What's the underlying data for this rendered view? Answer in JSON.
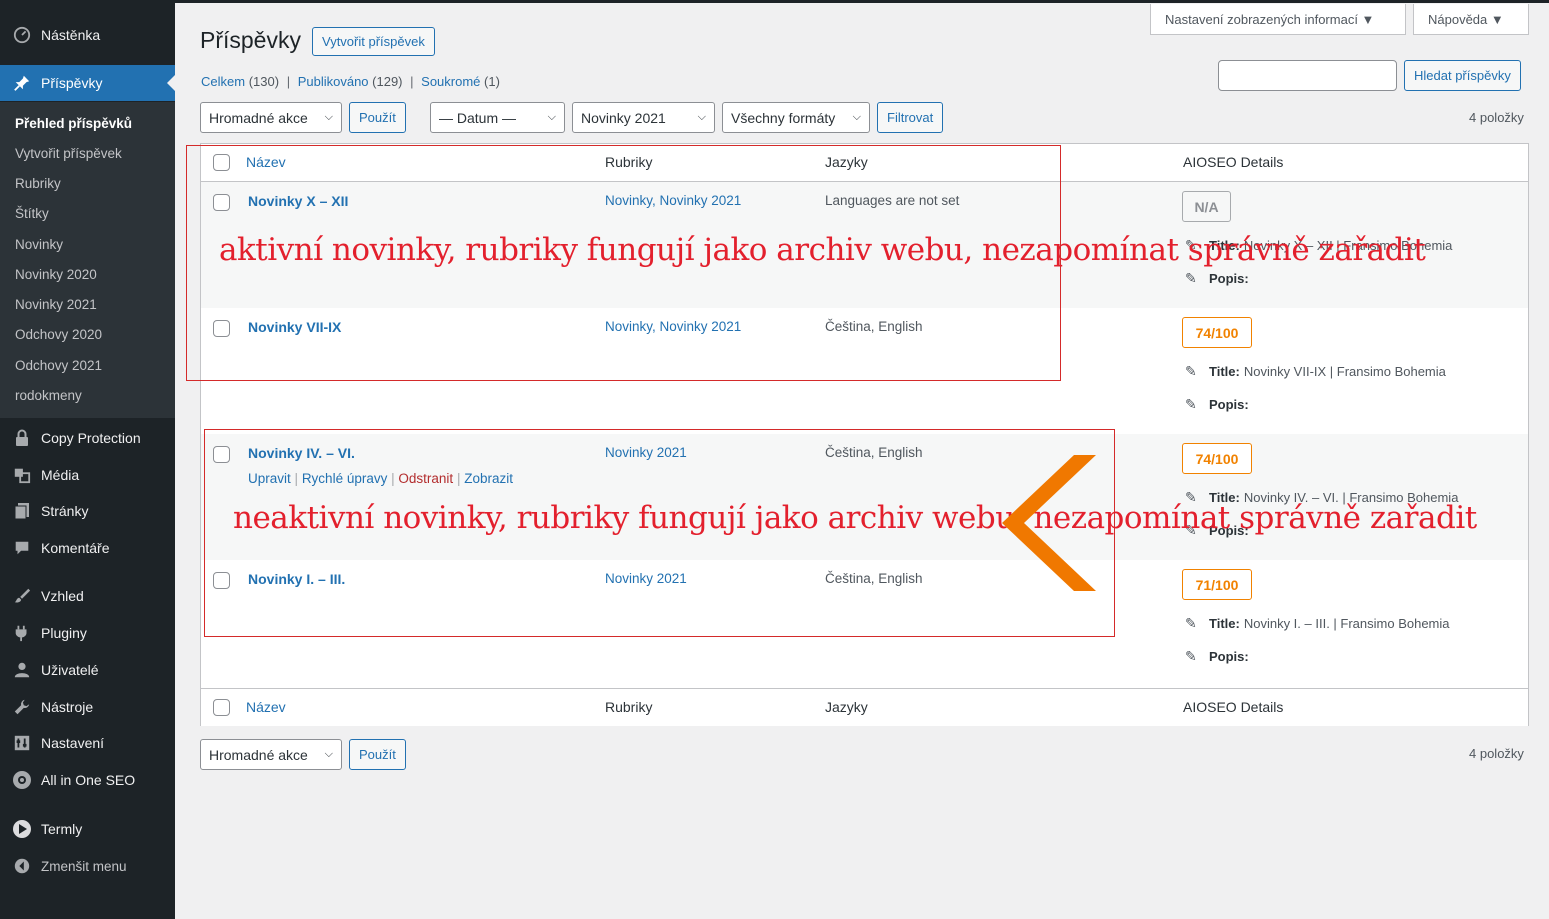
{
  "sidebar": {
    "items": [
      {
        "label": "Nástěnka",
        "icon": "dashboard-icon"
      },
      {
        "label": "Příspěvky",
        "icon": "pin-icon"
      },
      {
        "label": "Copy Protection",
        "icon": "lock-icon"
      },
      {
        "label": "Média",
        "icon": "media-icon"
      },
      {
        "label": "Stránky",
        "icon": "page-icon"
      },
      {
        "label": "Komentáře",
        "icon": "comment-icon"
      },
      {
        "label": "Vzhled",
        "icon": "brush-icon"
      },
      {
        "label": "Pluginy",
        "icon": "plugin-icon"
      },
      {
        "label": "Uživatelé",
        "icon": "user-icon"
      },
      {
        "label": "Nástroje",
        "icon": "wrench-icon"
      },
      {
        "label": "Nastavení",
        "icon": "settings-icon"
      },
      {
        "label": "All in One SEO",
        "icon": "aioseo-icon"
      },
      {
        "label": "Termly",
        "icon": "termly-icon"
      },
      {
        "label": "Zmenšit menu",
        "icon": "collapse-icon"
      }
    ],
    "submenu": [
      "Přehled příspěvků",
      "Vytvořit příspěvek",
      "Rubriky",
      "Štítky",
      "Novinky",
      "Novinky 2020",
      "Novinky 2021",
      "Odchovy 2020",
      "Odchovy 2021",
      "rodokmeny"
    ]
  },
  "screen_options": {
    "label": "Nastavení zobrazených informací ▼",
    "help": "Nápověda ▼"
  },
  "header": {
    "title": "Příspěvky",
    "add_new": "Vytvořit příspěvek"
  },
  "views": {
    "all": "Celkem",
    "all_count": "(130)",
    "published": "Publikováno",
    "published_count": "(129)",
    "private": "Soukromé",
    "private_count": "(1)",
    "sep": "|"
  },
  "search": {
    "button": "Hledat příspěvky",
    "value": ""
  },
  "filters": {
    "bulk": "Hromadné akce",
    "apply": "Použít",
    "date": "— Datum —",
    "category": "Novinky 2021",
    "format": "Všechny formáty",
    "filter": "Filtrovat",
    "count": "4 položky"
  },
  "table": {
    "columns": {
      "title": "Název",
      "categories": "Rubriky",
      "languages": "Jazyky",
      "seo": "AIOSEO Details"
    },
    "rows": [
      {
        "title": "Novinky X – XII",
        "categories": "Novinky, Novinky 2021",
        "languages": "Languages are not set",
        "score": "N/A",
        "seo_title_label": "Title:",
        "seo_title": "Novinky X – XII | Fransimo Bohemia",
        "seo_desc_label": "Popis:"
      },
      {
        "title": "Novinky VII-IX",
        "categories": "Novinky, Novinky 2021",
        "languages": "Čeština, English",
        "score": "74/100",
        "seo_title_label": "Title:",
        "seo_title": "Novinky VII-IX | Fransimo Bohemia",
        "seo_desc_label": "Popis:"
      },
      {
        "title": "Novinky IV. – VI.",
        "categories": "Novinky 2021",
        "languages": "Čeština, English",
        "score": "74/100",
        "seo_title_label": "Title:",
        "seo_title": "Novinky IV. – VI. | Fransimo Bohemia",
        "seo_desc_label": "Popis:"
      },
      {
        "title": "Novinky I. – III.",
        "categories": "Novinky 2021",
        "languages": "Čeština, English",
        "score": "71/100",
        "seo_title_label": "Title:",
        "seo_title": "Novinky I. – III. | Fransimo Bohemia",
        "seo_desc_label": "Popis:"
      }
    ],
    "row_actions": {
      "edit": "Upravit",
      "quick": "Rychlé úpravy",
      "trash": "Odstranit",
      "view": "Zobrazit",
      "sep": "|"
    }
  },
  "annotations": {
    "active": "aktivní novinky, rubriky fungují jako archiv webu, nezapomínat správně zařadit",
    "inactive": "neaktivní novinky, rubriky fungují jako archiv webu, nezapomínat správně zařadit"
  },
  "colors": {
    "accent": "#2271b1",
    "sidebar": "#1d2327",
    "score": "#f18200",
    "annotation": "#e3202d",
    "arrow": "#f07800"
  }
}
